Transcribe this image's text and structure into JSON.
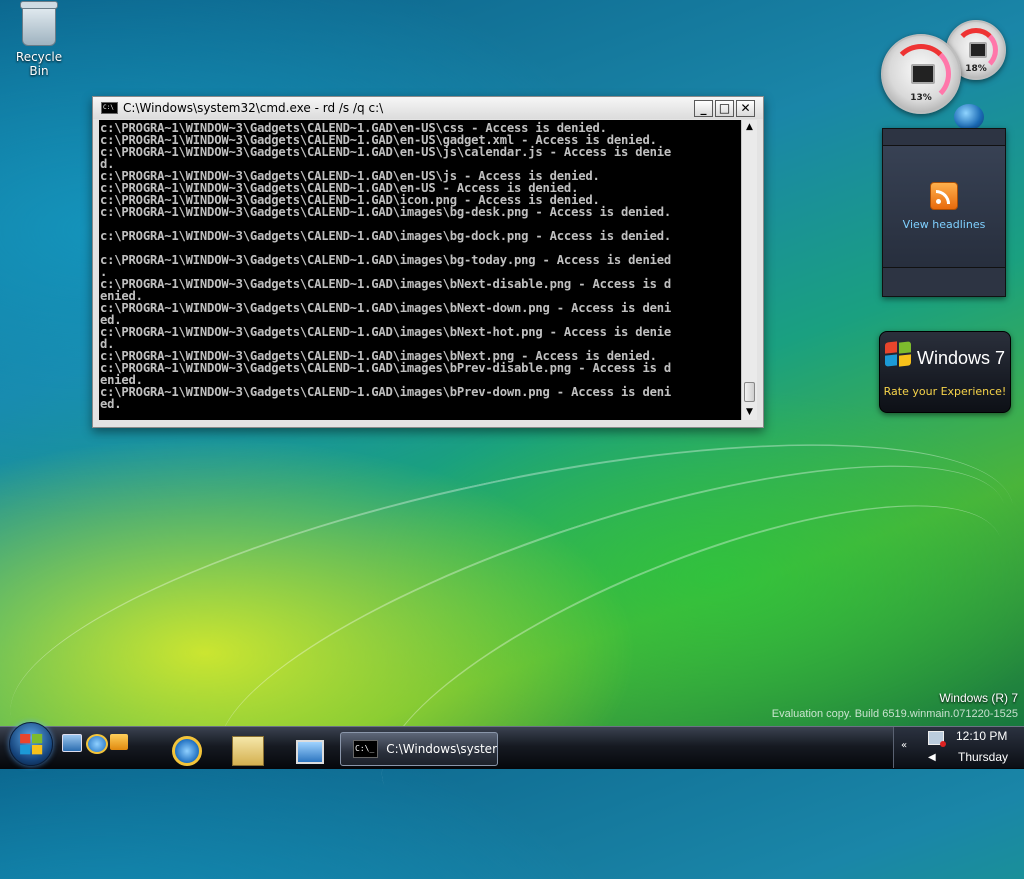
{
  "desktop": {
    "icons": [
      {
        "label": "Recycle Bin",
        "icon": "recycle-bin-icon"
      }
    ],
    "watermark": {
      "line1": "Windows (R) 7",
      "line2": "Evaluation copy. Build 6519.winmain.071220-1525"
    }
  },
  "cmd_window": {
    "title": "C:\\Windows\\system32\\cmd.exe - rd  /s /q c:\\",
    "buttons": {
      "minimize": "_",
      "maximize": "□",
      "close": "✕"
    },
    "scroll": {
      "up": "▲",
      "down": "▼"
    },
    "lines": [
      "c:\\PROGRA~1\\WINDOW~3\\Gadgets\\CALEND~1.GAD\\en-US\\css - Access is denied.",
      "c:\\PROGRA~1\\WINDOW~3\\Gadgets\\CALEND~1.GAD\\en-US\\gadget.xml - Access is denied.",
      "c:\\PROGRA~1\\WINDOW~3\\Gadgets\\CALEND~1.GAD\\en-US\\js\\calendar.js - Access is denie",
      "d.",
      "c:\\PROGRA~1\\WINDOW~3\\Gadgets\\CALEND~1.GAD\\en-US\\js - Access is denied.",
      "c:\\PROGRA~1\\WINDOW~3\\Gadgets\\CALEND~1.GAD\\en-US - Access is denied.",
      "c:\\PROGRA~1\\WINDOW~3\\Gadgets\\CALEND~1.GAD\\icon.png - Access is denied.",
      "c:\\PROGRA~1\\WINDOW~3\\Gadgets\\CALEND~1.GAD\\images\\bg-desk.png - Access is denied.",
      "",
      "c:\\PROGRA~1\\WINDOW~3\\Gadgets\\CALEND~1.GAD\\images\\bg-dock.png - Access is denied.",
      "",
      "c:\\PROGRA~1\\WINDOW~3\\Gadgets\\CALEND~1.GAD\\images\\bg-today.png - Access is denied",
      ".",
      "c:\\PROGRA~1\\WINDOW~3\\Gadgets\\CALEND~1.GAD\\images\\bNext-disable.png - Access is d",
      "enied.",
      "c:\\PROGRA~1\\WINDOW~3\\Gadgets\\CALEND~1.GAD\\images\\bNext-down.png - Access is deni",
      "ed.",
      "c:\\PROGRA~1\\WINDOW~3\\Gadgets\\CALEND~1.GAD\\images\\bNext-hot.png - Access is denie",
      "d.",
      "c:\\PROGRA~1\\WINDOW~3\\Gadgets\\CALEND~1.GAD\\images\\bNext.png - Access is denied.",
      "c:\\PROGRA~1\\WINDOW~3\\Gadgets\\CALEND~1.GAD\\images\\bPrev-disable.png - Access is d",
      "enied.",
      "c:\\PROGRA~1\\WINDOW~3\\Gadgets\\CALEND~1.GAD\\images\\bPrev-down.png - Access is deni",
      "ed."
    ]
  },
  "gadgets": {
    "cpu_meter": {
      "cpu_percent": "13%",
      "memory_percent": "18%"
    },
    "feed": {
      "link_text": "View headlines",
      "icon": "rss-icon"
    },
    "win7_promo": {
      "brand": "Windows 7",
      "subtitle": "Rate your Experience!"
    }
  },
  "taskbar": {
    "start_icon": "windows-flag-icon",
    "quick_launch": [
      "show-desktop-icon",
      "internet-explorer-icon",
      "media-player-icon"
    ],
    "pinned": [
      "internet-explorer-icon",
      "windows-explorer-icon",
      "computer-icon"
    ],
    "task_button": "C:\\Windows\\syster",
    "tray": {
      "time": "12:10 PM",
      "day": "Thursday",
      "chevron": "«",
      "volume_glyph": "◀"
    }
  },
  "colors": {
    "console_bg": "#000000",
    "console_text": "#c0c0c0",
    "feed_link": "#7fd0ff",
    "promo_subtitle": "#f5d34a"
  }
}
